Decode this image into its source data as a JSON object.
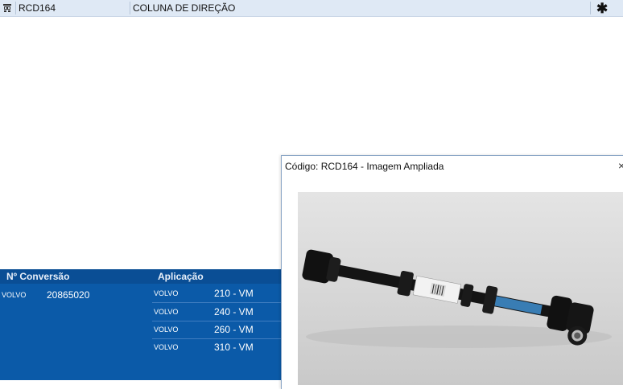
{
  "product_row": {
    "icon": "cart-icon",
    "code": "RCD164",
    "description": "COLUNA DE DIREÇÃO",
    "action_icon": "asterisk-icon",
    "action_symbol": "✱"
  },
  "conversion_panel": {
    "conversion_header": "Nº Conversão",
    "application_header": "Aplicação",
    "conversions": [
      {
        "brand": "VOLVO",
        "number": "20865020"
      }
    ],
    "applications": [
      {
        "brand": "VOLVO",
        "model": "210 - VM"
      },
      {
        "brand": "VOLVO",
        "model": "240 - VM"
      },
      {
        "brand": "VOLVO",
        "model": "260 - VM"
      },
      {
        "brand": "VOLVO",
        "model": "310 - VM"
      }
    ],
    "colors": {
      "panel": "#0b5aa8",
      "header": "#0a4e95"
    }
  },
  "image_popup": {
    "title": "Código: RCD164 - Imagem Ampliada",
    "close_symbol": "×"
  }
}
